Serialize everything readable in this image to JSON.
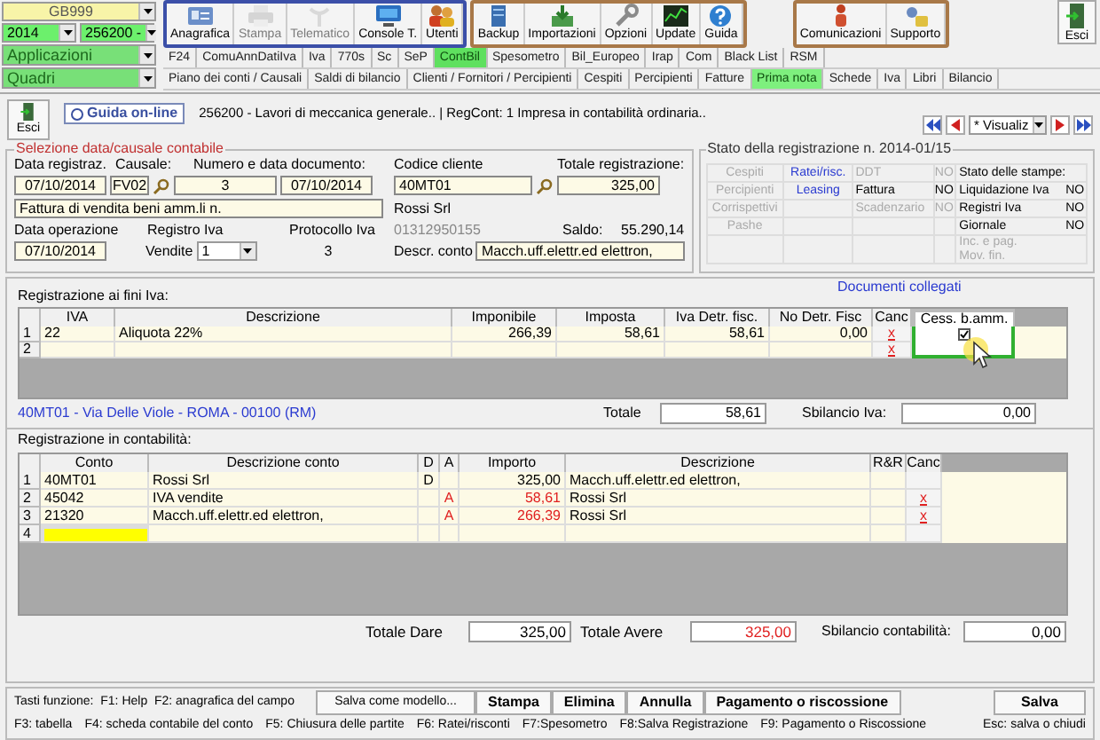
{
  "selectors": {
    "company": "GB999",
    "year": "2014",
    "activity": "256200 -",
    "applications": "Applicazioni",
    "sections": "Quadri"
  },
  "toolbar": [
    {
      "buttons": [
        {
          "label": "Anagrafica",
          "disabled": false
        },
        {
          "label": "Stampa",
          "disabled": true
        },
        {
          "label": "Telematico",
          "disabled": true
        },
        {
          "label": "Console T.",
          "disabled": false
        },
        {
          "label": "Utenti",
          "disabled": false
        }
      ]
    },
    {
      "buttons": [
        {
          "label": "Backup",
          "disabled": false
        },
        {
          "label": "Importazioni",
          "disabled": false
        },
        {
          "label": "Opzioni",
          "disabled": false
        },
        {
          "label": "Update",
          "disabled": false
        },
        {
          "label": "Guida",
          "disabled": false
        }
      ]
    },
    {
      "buttons": [
        {
          "label": "Comunicazioni",
          "disabled": false
        },
        {
          "label": "Supporto",
          "disabled": false
        }
      ]
    }
  ],
  "exit_button": {
    "label": "Esci"
  },
  "module_tabs": [
    {
      "label": "F24",
      "selected": false
    },
    {
      "label": "ComuAnnDatiIva",
      "selected": false
    },
    {
      "label": "Iva",
      "selected": false
    },
    {
      "label": "770s",
      "selected": false
    },
    {
      "label": "Sc",
      "selected": false
    },
    {
      "label": "SeP",
      "selected": false
    },
    {
      "label": "ContBil",
      "selected": true
    },
    {
      "label": "Spesometro",
      "selected": false
    },
    {
      "label": "Bil_Europeo",
      "selected": false
    },
    {
      "label": "Irap",
      "selected": false
    },
    {
      "label": "Com",
      "selected": false
    },
    {
      "label": "Black List",
      "selected": false
    },
    {
      "label": "RSM",
      "selected": false
    }
  ],
  "sub_tabs": [
    {
      "label": "Piano dei conti / Causali",
      "selected": false
    },
    {
      "label": "Saldi di bilancio",
      "selected": false
    },
    {
      "label": "Clienti / Fornitori / Percipienti",
      "selected": false
    },
    {
      "label": "Cespiti",
      "selected": false
    },
    {
      "label": "Percipienti",
      "selected": false
    },
    {
      "label": "Fatture",
      "selected": false
    },
    {
      "label": "Prima nota",
      "selected": true
    },
    {
      "label": "Schede",
      "selected": false
    },
    {
      "label": "Iva",
      "selected": false
    },
    {
      "label": "Libri",
      "selected": false
    },
    {
      "label": "Bilancio",
      "selected": false
    }
  ],
  "header": {
    "exit_label": "Esci",
    "help_label": "Guida on-line",
    "info": "256200 - Lavori di meccanica generale.. | RegCont: 1 Impresa  in contabilità ordinaria..",
    "view_select": "* Visualiz"
  },
  "selection": {
    "title": "Selezione data/causale contabile",
    "date_label": "Data registraz.",
    "date": "07/10/2014",
    "reason_label": "Causale:",
    "reason": "FV02",
    "doc_label": "Numero e data documento:",
    "doc_number": "3",
    "doc_date": "07/10/2014",
    "description": "Fattura di vendita beni amm.li n.",
    "op_date_label": "Data operazione",
    "op_date": "07/10/2014",
    "register_label": "Registro Iva",
    "register_type": "Vendite",
    "register_number": "1",
    "protocol_label": "Protocollo Iva",
    "protocol": "3",
    "client_label": "Codice cliente",
    "client_code": "40MT01",
    "total_label": "Totale registrazione:",
    "total": "325,00",
    "client_name": "Rossi Srl",
    "vat_number": "01312950155",
    "balance_label": "Saldo:",
    "balance": "55.290,14",
    "account_desc_label": "Descr. conto",
    "account_desc": "Macch.uff.elettr.ed elettron,"
  },
  "registration_state": {
    "title": "Stato della registrazione n. 2014-01/15",
    "modules": [
      {
        "label": "Cespiti",
        "enabled": false
      },
      {
        "label": "Percipienti",
        "enabled": false
      },
      {
        "label": "Corrispettivi",
        "enabled": false
      },
      {
        "label": "Pashe",
        "enabled": false
      }
    ],
    "links": [
      {
        "label": "Ratei/risc."
      },
      {
        "label": "Leasing"
      }
    ],
    "documents": [
      {
        "label": "DDT",
        "value": "NO",
        "enabled": false
      },
      {
        "label": "Fattura",
        "value": "NO",
        "enabled": true
      },
      {
        "label": "Scadenzario",
        "value": "NO",
        "enabled": false
      }
    ],
    "prints_title": "Stato delle stampe:",
    "prints": [
      {
        "label": "Liquidazione Iva",
        "value": "NO",
        "enabled": true
      },
      {
        "label": "Registri Iva",
        "value": "NO",
        "enabled": true
      },
      {
        "label": "Giornale",
        "value": "NO",
        "enabled": true
      },
      {
        "label": "Inc. e pag. Mov. fin.",
        "enabled": false
      }
    ]
  },
  "iva": {
    "title": "Registrazione ai fini Iva:",
    "linked_docs": "Documenti collegati",
    "columns": [
      "IVA",
      "Descrizione",
      "Imponibile",
      "Imposta",
      "Iva Detr. fisc.",
      "No Detr. Fisc",
      "Canc",
      "Cess. b.amm."
    ],
    "rows": [
      {
        "number": "1",
        "rate": "22",
        "description": "Aliquota 22%",
        "taxable": "266,39",
        "tax": "58,61",
        "deductible": "58,61",
        "non_deductible": "0,00",
        "delete": "x",
        "asset_sale": true
      },
      {
        "number": "2",
        "delete": "x",
        "asset_sale": false
      }
    ],
    "address": "40MT01 - Via Delle Viole - ROMA - 00100 (RM)",
    "total_label": "Totale",
    "total": "58,61",
    "imbalance_label": "Sbilancio Iva:",
    "imbalance": "0,00"
  },
  "accounting": {
    "title": "Registrazione in contabilità:",
    "columns": [
      "Conto",
      "Descrizione conto",
      "D",
      "A",
      "Importo",
      "Descrizione",
      "R&R",
      "Canc"
    ],
    "rows": [
      {
        "number": "1",
        "account": "40MT01",
        "account_desc": "Rossi Srl",
        "debit": "D",
        "amount": "325,00",
        "description": "Macch.uff.elettr.ed elettron,",
        "selected": false
      },
      {
        "number": "2",
        "account": "45042",
        "account_desc": "IVA vendite",
        "credit": "A",
        "amount": "58,61",
        "description": "Rossi Srl",
        "delete": "x",
        "selected": false
      },
      {
        "number": "3",
        "account": "21320",
        "account_desc": "Macch.uff.elettr.ed elettron,",
        "credit": "A",
        "amount": "266,39",
        "description": "Rossi Srl",
        "delete": "x",
        "selected": false
      },
      {
        "number": "4",
        "selected": true
      }
    ],
    "debit_label": "Totale Dare",
    "debit_total": "325,00",
    "credit_label": "Totale Avere",
    "credit_total": "325,00",
    "imbalance_label": "Sbilancio contabilità:",
    "imbalance": "0,00"
  },
  "footer": {
    "keys_line": "Tasti funzione:  F1: Help  F2: anagrafica del campo",
    "buttons": [
      {
        "label": "Salva come modello...",
        "kind": "template"
      },
      {
        "label": "Stampa",
        "kind": "action"
      },
      {
        "label": "Elimina",
        "kind": "action"
      },
      {
        "label": "Annulla",
        "kind": "action"
      },
      {
        "label": "Pagamento o riscossione",
        "kind": "action"
      },
      {
        "label": "Salva",
        "kind": "primary"
      }
    ],
    "hints": [
      "F3: tabella",
      "F4: scheda contabile del conto",
      "F5: Chiusura delle partite",
      "F6: Ratei/risconti",
      "F7:Spesometro",
      "F8:Salva Registrazione",
      "F9: Pagamento o Riscossione",
      "Esc: salva o chiudi"
    ]
  }
}
